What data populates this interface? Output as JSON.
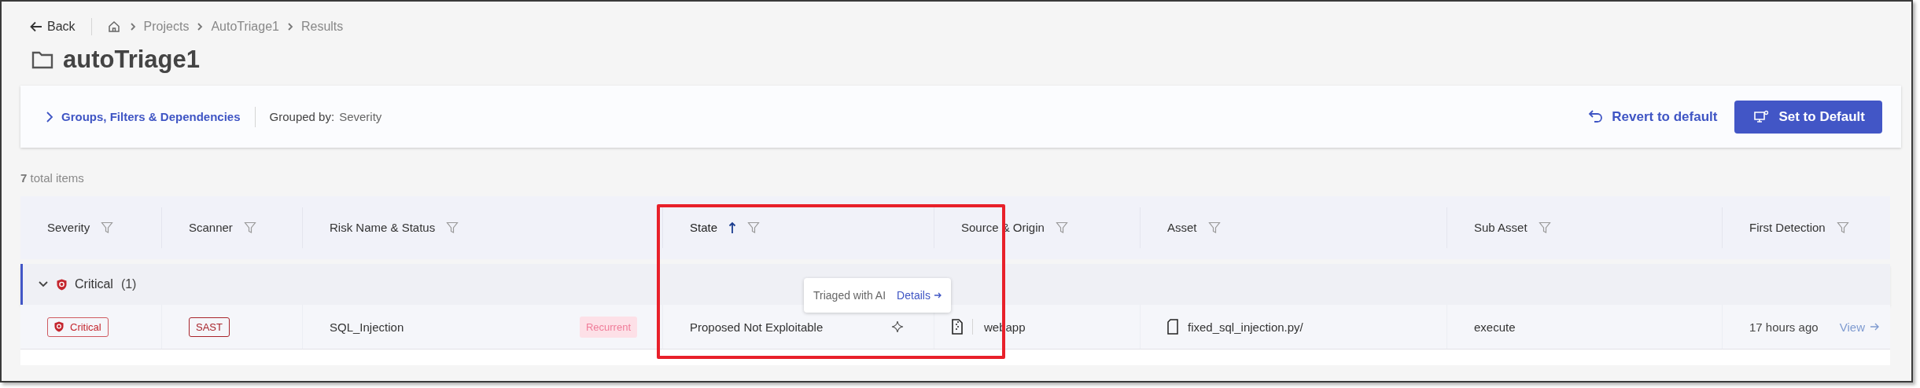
{
  "nav": {
    "back": "Back",
    "breadcrumbs": [
      "Projects",
      "AutoTriage1",
      "Results"
    ]
  },
  "title": "autoTriage1",
  "filter_bar": {
    "toggle": "Groups, Filters & Dependencies",
    "expanded": false,
    "grouped_by_label": "Grouped by:",
    "grouped_by_value": "Severity",
    "revert": "Revert to default",
    "set_default": "Set to Default"
  },
  "total": {
    "count": "7",
    "label": "total items"
  },
  "table": {
    "columns": [
      {
        "label": "Severity",
        "highlighted": false
      },
      {
        "label": "Scanner",
        "highlighted": false
      },
      {
        "label": "Risk Name & Status",
        "highlighted": false
      },
      {
        "label": "State",
        "sorted": true,
        "highlighted": true
      },
      {
        "label": "Source & Origin",
        "highlighted": false
      },
      {
        "label": "Asset",
        "highlighted": false
      },
      {
        "label": "Sub Asset",
        "highlighted": false
      },
      {
        "label": "First Detection",
        "highlighted": false
      }
    ],
    "groups": [
      {
        "label": "Critical",
        "count": "(1)",
        "expanded": true,
        "rows": [
          {
            "severity": "Critical",
            "scanner": "SAST",
            "risk": "SQL_Injection",
            "status": "Recurrent",
            "state": "Proposed Not Exploitable",
            "ai_triaged": true,
            "tooltip": {
              "text": "Triaged with AI",
              "link": "Details"
            },
            "source": "webapp",
            "asset": "fixed_sql_injection.py/",
            "sub_asset": "execute",
            "first_detection": "17 hours ago",
            "action": "View"
          }
        ]
      }
    ]
  }
}
